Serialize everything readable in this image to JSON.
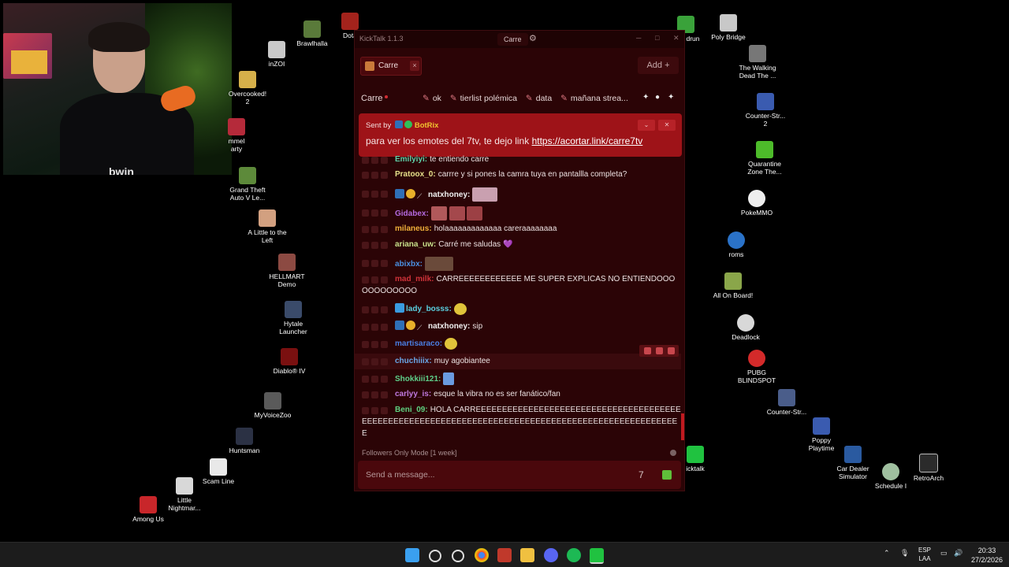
{
  "desktop_icons": [
    {
      "name": "Brawlhalla",
      "color": "#5a7a3a"
    },
    {
      "name": "Dota",
      "color": "#a3231c"
    },
    {
      "name": "inZOI",
      "color": "#c9c9c9"
    },
    {
      "name": "Overcooked!\n2",
      "color": "#d6b04a"
    },
    {
      "name": "mmel\narty",
      "color": "#b52a3a"
    },
    {
      "name": "Grand Theft\nAuto V Le...",
      "color": "#5d8a3a"
    },
    {
      "name": "A Little to the\nLeft",
      "color": "#d2a080"
    },
    {
      "name": "HELLMART\nDemo",
      "color": "#8c4a42"
    },
    {
      "name": "Hytale\nLauncher",
      "color": "#3a4b6a"
    },
    {
      "name": "Diablo® IV",
      "color": "#7a1010"
    },
    {
      "name": "MyVoiceZoo",
      "color": "#5a5a5a"
    },
    {
      "name": "Huntsman",
      "color": "#2b3144"
    },
    {
      "name": "Scam Line",
      "color": "#e9e9e9"
    },
    {
      "name": "Little\nNightmar...",
      "color": "#d8d8d8"
    },
    {
      "name": "Among Us",
      "color": "#c8262a"
    },
    {
      "name": "drun",
      "color": "#3aa23a"
    },
    {
      "name": "Poly Bridge",
      "color": "#c8c8c8"
    },
    {
      "name": "The Walking\nDead The ...",
      "color": "#777777"
    },
    {
      "name": "Counter-Str...\n2",
      "color": "#3a5bb0"
    },
    {
      "name": "Quarantine\nZone The...",
      "color": "#4dbb2a"
    },
    {
      "name": "PokeMMO",
      "color": "#eeeeee"
    },
    {
      "name": "roms",
      "color": "#2a72c8"
    },
    {
      "name": "All On Board!",
      "color": "#8aa64a"
    },
    {
      "name": "Deadlock",
      "color": "#d8d8d8"
    },
    {
      "name": "PUBG\nBLINDSPOT",
      "color": "#d32a2a"
    },
    {
      "name": "Counter-Str...",
      "color": "#4a5d8a"
    },
    {
      "name": "icktalk",
      "color": "#20c240"
    },
    {
      "name": "Poppy\nPlaytime",
      "color": "#3a5bb0"
    },
    {
      "name": "Car Dealer\nSimulator",
      "color": "#2a5aa0"
    },
    {
      "name": "Schedule I",
      "color": "#9fbf9f"
    },
    {
      "name": "RetroArch",
      "color": "#2b2b2b"
    }
  ],
  "webcam": {
    "brand_text": "bwin"
  },
  "app": {
    "title": "KickTalk 1.1.3",
    "channel_chip": "Carre",
    "tab_label": "Carre",
    "tab_close": "×",
    "add_label": "Add  +",
    "channel_name": "Carre",
    "pinned_topics": [
      "ok",
      "tierlist polémica",
      "data",
      "mañana strea..."
    ],
    "pinned": {
      "sent_by": "Sent by",
      "bot_name": "BotRix",
      "message": "para ver los emotes del 7tv, te dejo link ",
      "link": "https://acortar.link/carre7tv"
    },
    "messages": [
      {
        "user": "Emilyiyi:",
        "color": "#5fd0a8",
        "text": "te entiendo carre"
      },
      {
        "user": "Pratoox_0:",
        "color": "#e6e08a",
        "text": "carrre y si pones la camra tuya en pantallla completa?"
      },
      {
        "user": "natxhoney:",
        "color": "#f0f0f0",
        "text": ""
      },
      {
        "user": "Gidabex:",
        "color": "#b46adf",
        "text": ""
      },
      {
        "user": "milaneus:",
        "color": "#f0b03a",
        "text": "holaaaaaaaaaaaaa careraaaaaaaa"
      },
      {
        "user": "ariana_uw:",
        "color": "#c7e08a",
        "text": "Carré me saludas 💜"
      },
      {
        "user": "abixbx:",
        "color": "#4a90e2",
        "text": ""
      },
      {
        "user": "mad_milk:",
        "color": "#d0333a",
        "text": "CARREEEEEEEEEEEE ME SUPER EXPLICAS NO ENTIENDOOOOOOOOOOOO"
      },
      {
        "user": "lady_bosss:",
        "color": "#5ad0e0",
        "text": ""
      },
      {
        "user": "natxhoney:",
        "color": "#f0f0f0",
        "text": "sip"
      },
      {
        "user": "martisaraco:",
        "color": "#4a7ee2",
        "text": ""
      },
      {
        "user": "chuchiiix:",
        "color": "#6aa8e8",
        "text": "muy agobiantee"
      },
      {
        "user": "Shokkiii121:",
        "color": "#5fd08a",
        "text": ""
      },
      {
        "user": "carlyy_is:",
        "color": "#c07ae0",
        "text": "esque la vibra no es ser fanático/fan"
      },
      {
        "user": "Beni_09:",
        "color": "#5fd080",
        "text": "HOLA CARREEEEEEEEEEEEEEEEEEEEEEEEEEEEEEEEEEEEEEEEEEEEEEEEEEEEEEEEEEEEEEEEEEEEEEEEEEEEEEEEEEEEEEEEEEEEEEEEEEEE"
      }
    ],
    "mode_text": "Followers Only Mode [1 week]",
    "input_placeholder": "Send a message..."
  },
  "taskbar": {
    "lang_top": "ESP",
    "lang_bottom": "LAA",
    "time": "20:33",
    "date": "27/2/2026"
  }
}
